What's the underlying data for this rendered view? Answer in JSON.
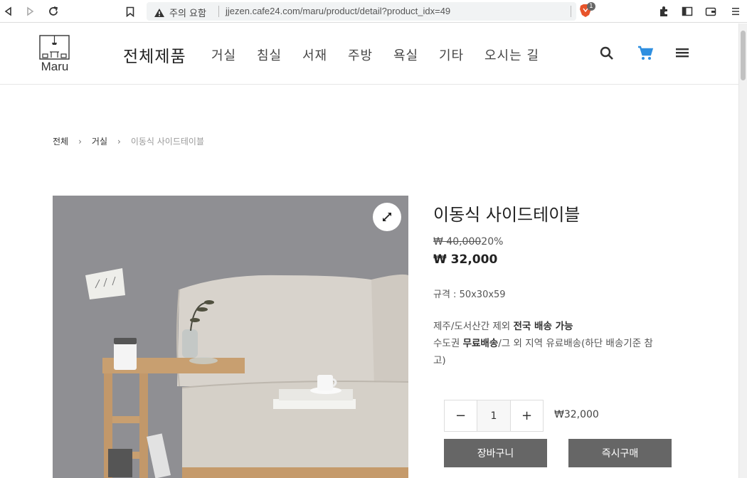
{
  "browser": {
    "security_label": "주의 요함",
    "url": "jjezen.cafe24.com/maru/product/detail?product_idx=49",
    "brave_badge": "1"
  },
  "header": {
    "logo_text": "Maru",
    "nav_main": "전체제품",
    "nav_items": [
      "거실",
      "침실",
      "서재",
      "주방",
      "욕실",
      "기타",
      "오시는 길"
    ]
  },
  "breadcrumb": [
    "전체",
    "거실",
    "이동식 사이드테이블"
  ],
  "breadcrumb_sep": "›",
  "product": {
    "title": "이동식 사이드테이블",
    "original_price": "₩ 40,000",
    "discount": "20%",
    "price": "₩ 32,000",
    "spec": "규격 : 50x30x59",
    "ship_line1_a": "제주/도서산간 제외 ",
    "ship_line1_b": "전국 배송 가능",
    "ship_line2_a": "수도권 ",
    "ship_line2_b": "무료배송",
    "ship_line2_c": "/그 외 지역 유료배송(하단 배송기준 참고)",
    "qty_value": "1",
    "qty_minus": "−",
    "qty_plus": "+",
    "total": "₩32,000",
    "cart_label": "장바구니",
    "buy_label": "즉시구매"
  },
  "colors": {
    "cart_icon": "#2f8fe0",
    "button_bg": "#666666",
    "image_bg": "#8f8f93"
  }
}
